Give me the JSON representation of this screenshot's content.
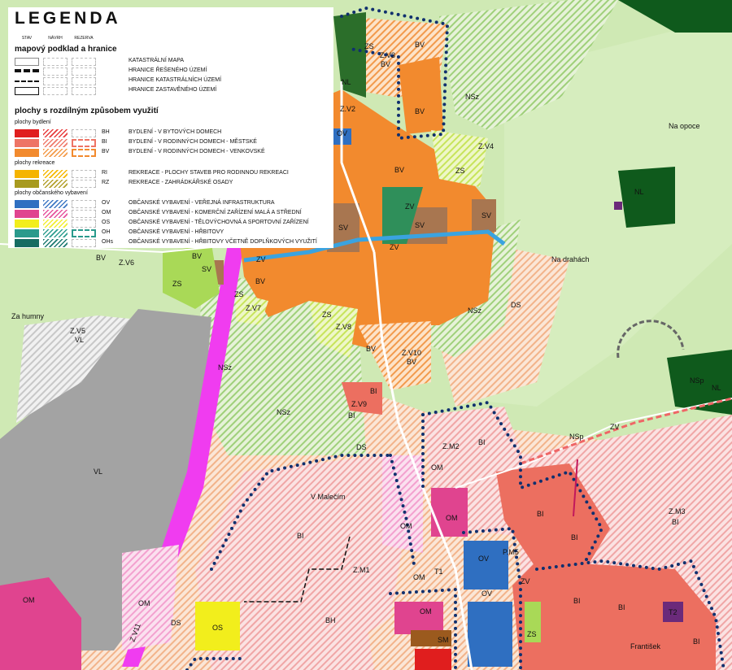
{
  "legend": {
    "title": "LEGENDA",
    "columns": [
      "STAV",
      "NÁVRH",
      "REZERVA"
    ],
    "sections": {
      "base": "mapový podklad a hranice",
      "uses": "plochy s rozdílným způsobem využití"
    },
    "base_items": [
      {
        "desc": "KATASTRÁLNÍ MAPA"
      },
      {
        "desc": "HRANICE ŘEŠENÉHO ÚZEMÍ"
      },
      {
        "desc": "HRANICE KATASTRÁLNÍCH ÚZEMÍ"
      },
      {
        "desc": "HRANICE ZASTAVĚNÉHO ÚZEMÍ"
      }
    ],
    "groups": [
      {
        "label": "plochy bydlení",
        "items": [
          {
            "code": "BH",
            "desc": "BYDLENÍ - V BYTOVÝCH DOMECH",
            "color": "#e01e1e",
            "hatch": "hatch-bh"
          },
          {
            "code": "BI",
            "desc": "BYDLENÍ - V RODINNÝCH DOMECH - MĚSTSKÉ",
            "color": "#ee7465",
            "hatch": "hatch-bi"
          },
          {
            "code": "BV",
            "desc": "BYDLENÍ - V RODINNÝCH DOMECH - VENKOVSKÉ",
            "color": "#f28a2e",
            "hatch": "hatch-bv"
          }
        ]
      },
      {
        "label": "plochy rekreace",
        "items": [
          {
            "code": "RI",
            "desc": "REKREACE - PLOCHY STAVEB PRO RODINNOU REKREACI",
            "color": "#f5b400",
            "hatch": "hatch-ri"
          },
          {
            "code": "RZ",
            "desc": "REKREACE - ZAHRÁDKÁŘSKÉ OSADY",
            "color": "#a89a1f",
            "hatch": "hatch-rz"
          }
        ]
      },
      {
        "label": "plochy občanského vybavení",
        "items": [
          {
            "code": "OV",
            "desc": "OBČANSKÉ VYBAVENÍ - VEŘEJNÁ INFRASTRUKTURA",
            "color": "#2f6fc1",
            "hatch": "hatch-ov"
          },
          {
            "code": "OM",
            "desc": "OBČANSKÉ VYBAVENÍ - KOMERČNÍ ZAŘÍZENÍ MALÁ A STŘEDNÍ",
            "color": "#e0448f",
            "hatch": "hatch-om"
          },
          {
            "code": "OS",
            "desc": "OBČANSKÉ VYBAVENÍ - TĚLOVÝCHOVNÁ A SPORTOVNÍ ZAŘÍZENÍ",
            "color": "#f2ee1c",
            "hatch": "hatch-os"
          },
          {
            "code": "OH",
            "desc": "OBČANSKÉ VYBAVENÍ - HŘBITOVY",
            "color": "#2a9a8c",
            "hatch": "hatch-oh"
          },
          {
            "code": "OHs",
            "desc": "OBČANSKÉ VYBAVENÍ - HŘBITOVY VČETNĚ DOPLŇKOVÝCH VYUŽITÍ",
            "color": "#166c62",
            "hatch": "hatch-ohs"
          }
        ]
      }
    ]
  },
  "map": {
    "place_names": [
      "Na opoce",
      "Na drahách",
      "Za humny",
      "V Malečím",
      "František"
    ],
    "zone_labels": [
      "ZS",
      "Z.V3",
      "BV",
      "NL",
      "NSz",
      "Z.V2",
      "Z.V4",
      "OV",
      "SV",
      "ZV",
      "DS",
      "NSp",
      "Z.V5",
      "VL",
      "Z.V6",
      "Z.V7",
      "Z.V8",
      "Z.V9",
      "Z.V10",
      "BI",
      "Z.M1",
      "Z.M2",
      "Z.M3",
      "P.M5",
      "OM",
      "BH",
      "OS",
      "SM",
      "Z.V11",
      "T1",
      "T2"
    ]
  },
  "colors": {
    "green_background": "#cfe9b4",
    "forest": "#0f5a1c",
    "industrial": "#9c9c9c",
    "rail": "#f03cf0",
    "dotted_boundary": "#10306e"
  }
}
